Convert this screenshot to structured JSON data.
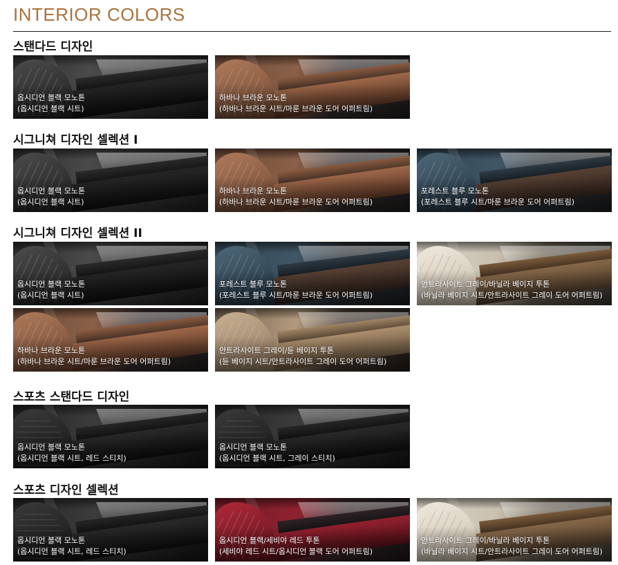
{
  "page_title": "INTERIOR COLORS",
  "sections": [
    {
      "title": "스탠다드 디자인",
      "items": [
        {
          "line1": "옵시디언 블랙 모노톤",
          "line2": "(옵시디언 블랙 시트)"
        },
        {
          "line1": "하바나 브라운 모노톤",
          "line2": "(하바나 브라운 시트/마룬 브라운 도어 어퍼트림)"
        }
      ]
    },
    {
      "title": "시그니쳐 디자인 셀렉션 I",
      "items": [
        {
          "line1": "옵시디언 블랙 모노톤",
          "line2": "(옵시디언 블랙 시트)"
        },
        {
          "line1": "하바나 브라운 모노톤",
          "line2": "(하바나 브라운 시트/마룬 브라운 도어 어퍼트림)"
        },
        {
          "line1": "포레스트 블루 모노톤",
          "line2": "(포레스트 블루 시트/마룬 브라운 도어 어퍼트림)"
        }
      ]
    },
    {
      "title": "시그니쳐 디자인 셀렉션 II",
      "items": [
        {
          "line1": "옵시디언 블랙 모노톤",
          "line2": "(옵시디언 블랙 시트)"
        },
        {
          "line1": "포레스트 블루 모노톤",
          "line2": "(포레스트 블루 시트/마룬 브라운 도어 어퍼트림)"
        },
        {
          "line1": "안트라사이트 그레이/바닐라 베이지 투톤",
          "line2": "(바닐라 베이지 시트/안트라사이트 그레이 도어 어퍼트림)"
        },
        {
          "line1": "하바나 브라운 모노톤",
          "line2": "(하바나 브라운 시트/마룬 브라운 도어 어퍼트림)"
        },
        {
          "line1": "안트라사이트 그레이/듄 베이지 투톤",
          "line2": "(듄 베이지 시트/안트라사이트 그레이 도어 어퍼트림)"
        }
      ]
    },
    {
      "title": "스포츠 스탠다드 디자인",
      "items": [
        {
          "line1": "옵시디언 블랙 모노톤",
          "line2": "(옵시디언 블랙 시트, 레드 스티치)"
        },
        {
          "line1": "옵시디언 블랙 모노톤",
          "line2": "(옵시디언 블랙 시트, 그레이 스티치)"
        }
      ]
    },
    {
      "title": "스포츠 디자인 셀렉션",
      "items": [
        {
          "line1": "옵시디언 블랙 모노톤",
          "line2": "(옵시디언 블랙 시트, 레드 스티치)"
        },
        {
          "line1": "옵시디언 블랙/세비야 레드 투톤",
          "line2": "(세비야 레드 시트/옵시디언 블랙 도어 어퍼트림)"
        },
        {
          "line1": "안트라사이트 그레이/바닐라 베이지 투톤",
          "line2": "(바닐라 베이지 시트/안트라사이트 그레이 도어 어퍼트림)"
        }
      ]
    }
  ],
  "colors": {
    "accent_title": "#a9713d",
    "rule": "#1b1b1b"
  }
}
